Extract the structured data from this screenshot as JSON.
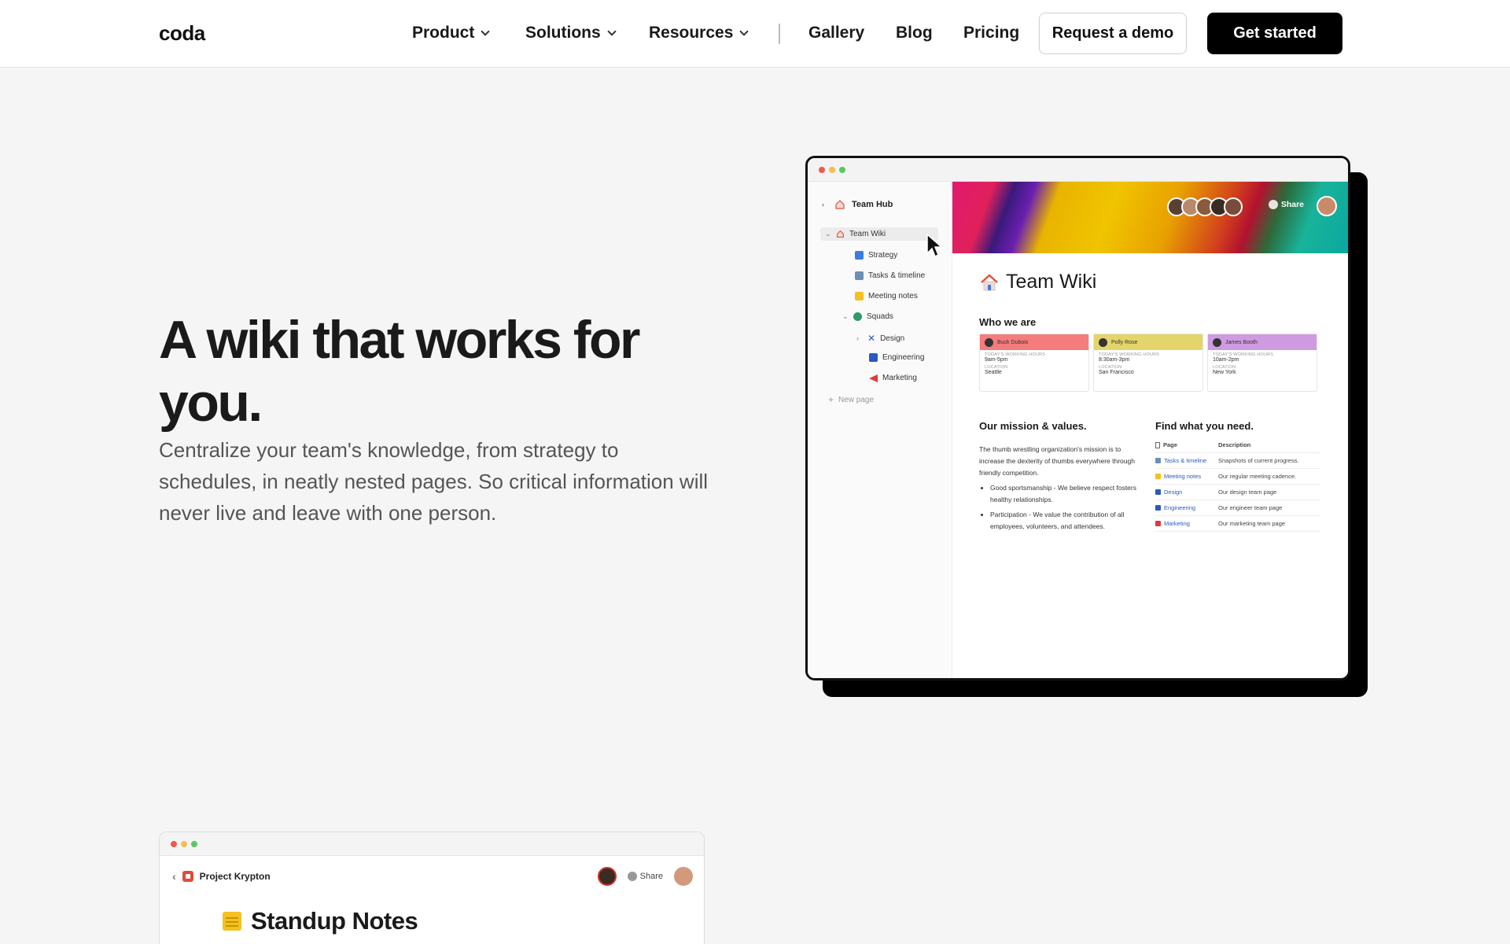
{
  "nav": {
    "logo": "coda",
    "items": [
      {
        "label": "Product",
        "dropdown": true
      },
      {
        "label": "Solutions",
        "dropdown": true
      },
      {
        "label": "Resources",
        "dropdown": true
      },
      {
        "label": "Gallery"
      },
      {
        "label": "Blog"
      },
      {
        "label": "Pricing"
      }
    ],
    "demo_label": "Request a demo",
    "start_label": "Get started"
  },
  "hero": {
    "title": "A wiki that works for you.",
    "description": "Centralize your team's knowledge, from strategy to schedules, in neatly nested pages. So critical information will never live and leave with one person."
  },
  "mockup": {
    "hub_title": "Team Hub",
    "sidebar": [
      {
        "label": "Team Wiki",
        "color": "#e0523a"
      },
      {
        "label": "Strategy",
        "color": "#3d7be0"
      },
      {
        "label": "Tasks & timeline",
        "color": "#6b8fb5"
      },
      {
        "label": "Meeting notes",
        "color": "#f5c021"
      },
      {
        "label": "Squads",
        "color": "#2f9a6a"
      },
      {
        "label": "Design",
        "color": "#2b59c3"
      },
      {
        "label": "Engineering",
        "color": "#2b59c3"
      },
      {
        "label": "Marketing",
        "color": "#e03a3a"
      }
    ],
    "new_page": "New page",
    "share": "Share",
    "page_title": "Team Wiki",
    "who_we_are": "Who we are",
    "people": [
      {
        "name": "Buck Dubois",
        "hours_label": "TODAY'S WORKING HOURS",
        "hours": "9am-5pm",
        "loc_label": "LOCATION",
        "location": "Seattle",
        "color": "#f47c7c"
      },
      {
        "name": "Polly Rose",
        "hours_label": "TODAY'S WORKING HOURS",
        "hours": "8:30am-3pm",
        "loc_label": "LOCATION",
        "location": "San Francisco",
        "color": "#e3d56b"
      },
      {
        "name": "James Booth",
        "hours_label": "TODAY'S WORKING HOURS",
        "hours": "10am-2pm",
        "loc_label": "LOCATION",
        "location": "New York",
        "color": "#cf9be0"
      }
    ],
    "mission_title": "Our mission & values.",
    "mission_text": "The thumb wrestling organization's mission is to increase the dexterity of thumbs everywhere through friendly competition.",
    "bullets": [
      "Good sportsmanship - We believe respect fosters healthy relationships.",
      "Participation - We value the contribution of all employees, volunteers, and attendees."
    ],
    "find_title": "Find what you need.",
    "table_headers": {
      "page": "Page",
      "description": "Description"
    },
    "table_rows": [
      {
        "page": "Tasks & timeline",
        "description": "Snapshots of current progress.",
        "color": "#6b8fb5"
      },
      {
        "page": "Meeting notes",
        "description": "Our regular meeting cadence.",
        "color": "#f5c021"
      },
      {
        "page": "Design",
        "description": "Our design team page",
        "color": "#2b59c3"
      },
      {
        "page": "Engineering",
        "description": "Our engineer team page",
        "color": "#2b59c3"
      },
      {
        "page": "Marketing",
        "description": "Our marketing team page",
        "color": "#e03a3a"
      }
    ]
  },
  "mockup2": {
    "project": "Project Krypton",
    "share": "Share",
    "title": "Standup Notes"
  }
}
